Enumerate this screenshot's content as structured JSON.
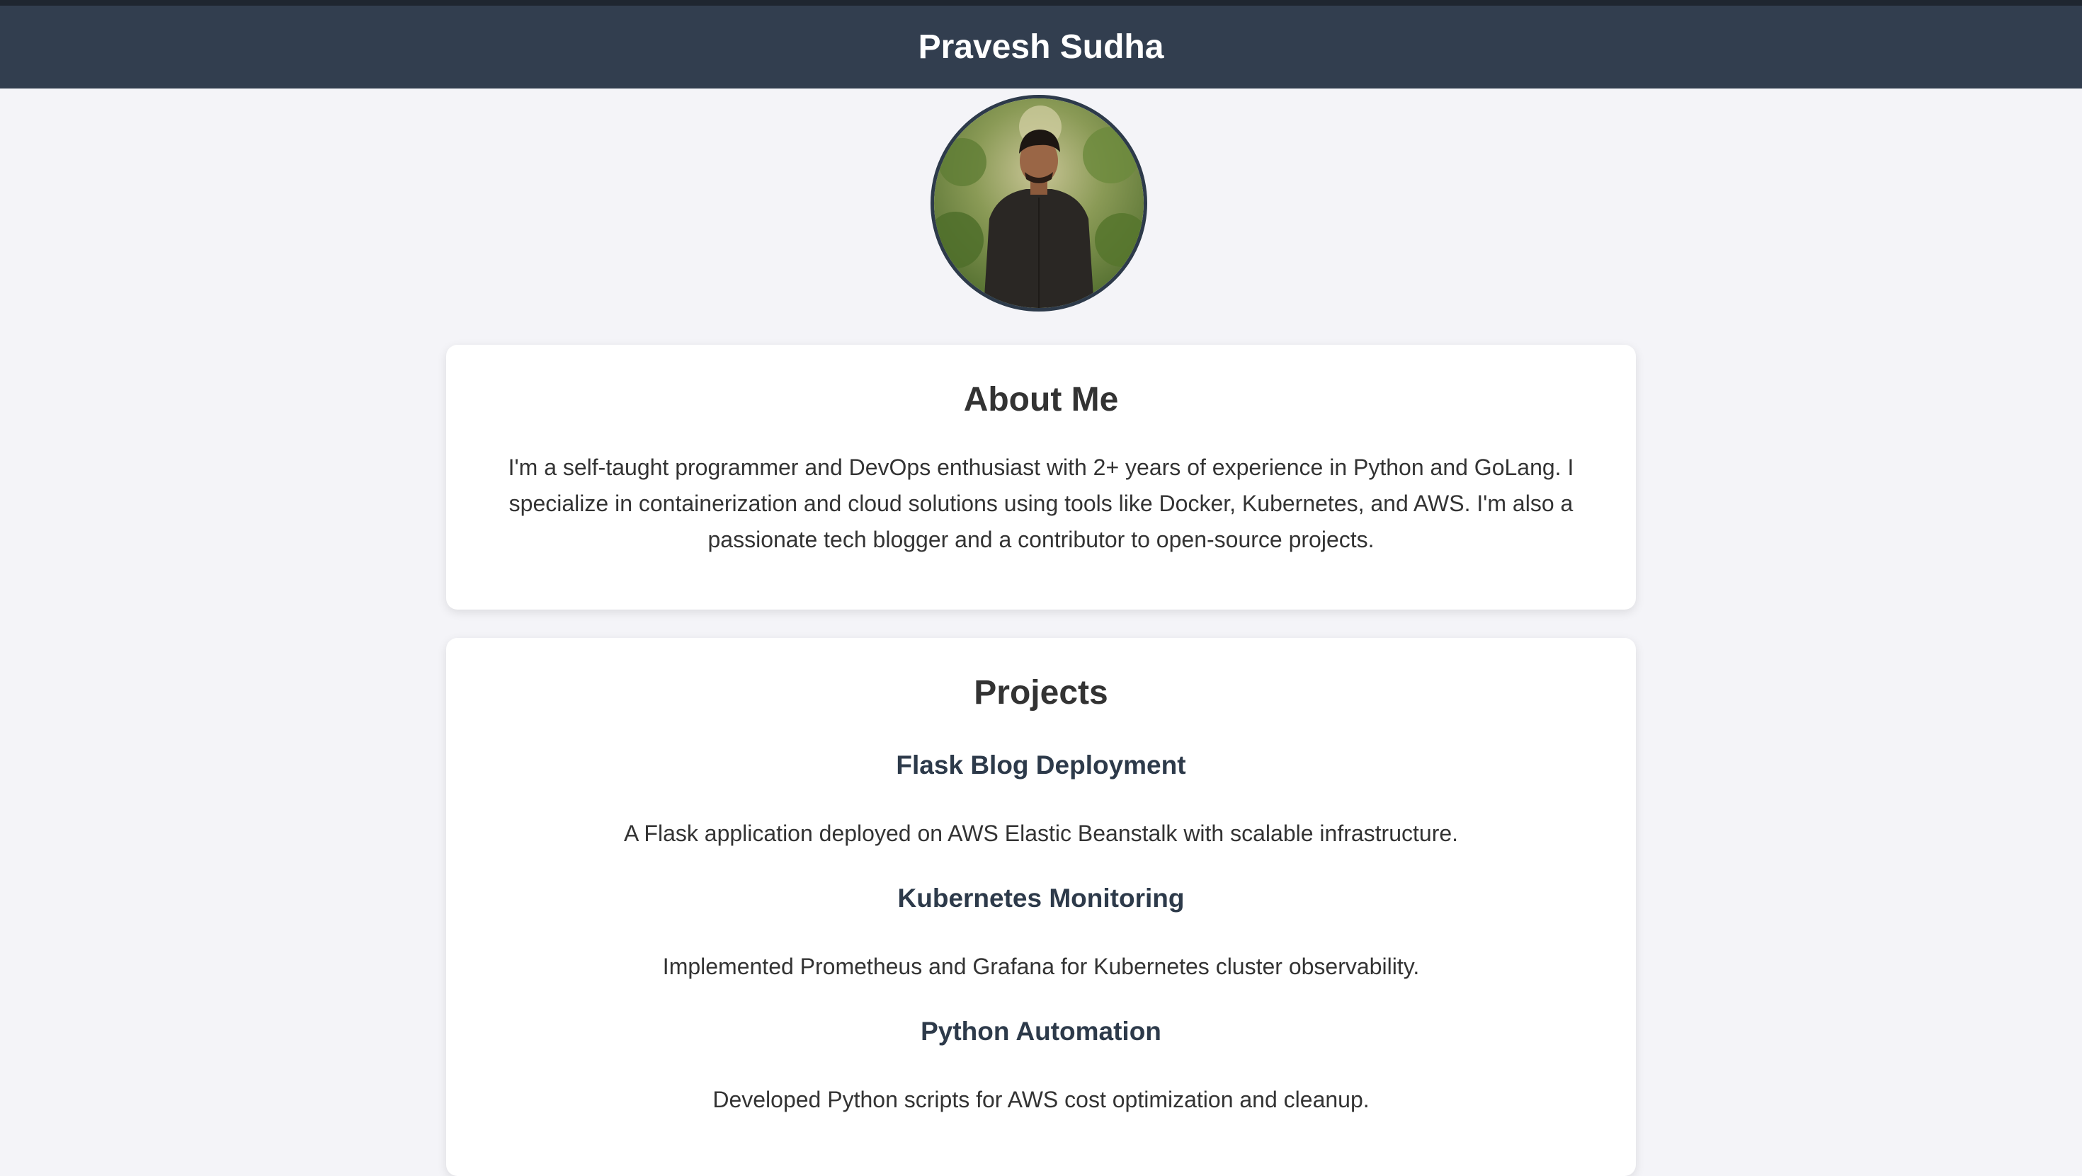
{
  "colors": {
    "header_bg": "#323e4f",
    "page_bg": "#f4f4f8",
    "card_bg": "#ffffff",
    "project_title": "#2d3a4a"
  },
  "header": {
    "title": "Pravesh Sudha"
  },
  "profile": {
    "avatar": "profile-photo"
  },
  "about": {
    "heading": "About Me",
    "text": "I'm a self-taught programmer and DevOps enthusiast with 2+ years of experience in Python and GoLang. I specialize in containerization and cloud solutions using tools like Docker, Kubernetes, and AWS. I'm also a passionate tech blogger and a contributor to open-source projects."
  },
  "projects": {
    "heading": "Projects",
    "items": [
      {
        "title": "Flask Blog Deployment",
        "description": "A Flask application deployed on AWS Elastic Beanstalk with scalable infrastructure."
      },
      {
        "title": "Kubernetes Monitoring",
        "description": "Implemented Prometheus and Grafana for Kubernetes cluster observability."
      },
      {
        "title": "Python Automation",
        "description": "Developed Python scripts for AWS cost optimization and cleanup."
      }
    ]
  }
}
